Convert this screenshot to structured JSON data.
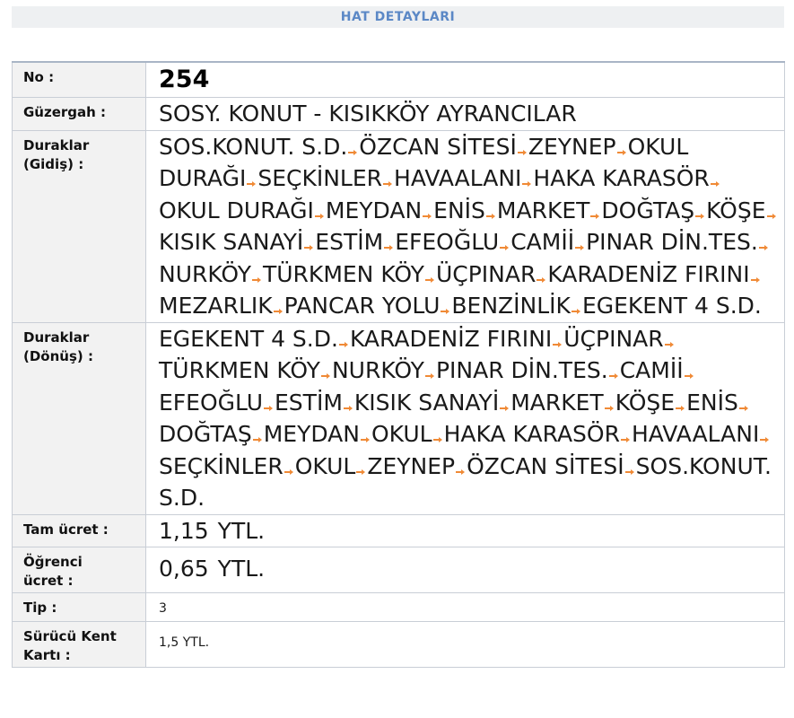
{
  "header": {
    "title": "HAT DETAYLARI"
  },
  "details": {
    "no_label": "No :",
    "no_value": "254",
    "route_label": "Güzergah :",
    "route_value": "SOSY. KONUT - KISIKKÖY AYRANCILAR",
    "stops_out_label_1": "Duraklar",
    "stops_out_label_2": "(Gidiş) :",
    "stops_out": [
      "SOS.KONUT. S.D.",
      "ÖZCAN SİTESİ",
      "ZEYNEP",
      "OKUL DURAĞI",
      "SEÇKİNLER",
      "HAVAALANI",
      "HAKA KARASÖR",
      "OKUL DURAĞI",
      "MEYDAN",
      "ENİS",
      "MARKET",
      "DOĞTAŞ",
      "KÖŞE",
      "KISIK SANAYİ",
      "ESTİM",
      "EFEOĞLU",
      "CAMİİ",
      "PINAR DİN.TES.",
      "NURKÖY",
      "TÜRKMEN KÖY",
      "ÜÇPINAR",
      "KARADENİZ FIRINI",
      "MEZARLIK",
      "PANCAR YOLU",
      "BENZİNLİK",
      "EGEKENT 4 S.D."
    ],
    "stops_back_label_1": "Duraklar",
    "stops_back_label_2": "(Dönüş) :",
    "stops_back": [
      "EGEKENT 4 S.D.",
      "KARADENİZ FIRINI",
      "ÜÇPINAR",
      "TÜRKMEN KÖY",
      "NURKÖY",
      "PINAR DİN.TES.",
      "CAMİİ",
      "EFEOĞLU",
      "ESTİM",
      "KISIK SANAYİ",
      "MARKET",
      "KÖŞE",
      "ENİS",
      "DOĞTAŞ",
      "MEYDAN",
      "OKUL",
      "HAKA KARASÖR",
      "HAVAALANI",
      "SEÇKİNLER",
      "OKUL",
      "ZEYNEP",
      "ÖZCAN SİTESİ",
      "SOS.KONUT. S.D."
    ],
    "full_fare_label": "Tam ücret :",
    "full_fare_amount": "1,15",
    "full_fare_unit": "YTL.",
    "student_fare_label_1": "Öğrenci",
    "student_fare_label_2": "ücret :",
    "student_fare_amount": "0,65",
    "student_fare_unit": "YTL.",
    "type_label": "Tip :",
    "type_value": "3",
    "driver_card_label_1": "Sürücü Kent",
    "driver_card_label_2": "Kartı :",
    "driver_card_value": "1,5 YTL."
  },
  "icons": {
    "stop_separator": "arrow-right-icon",
    "arrow_color": "#f08a36"
  },
  "colors": {
    "header_text": "#5b88c6",
    "header_bg": "#eef0f2",
    "label_bg": "#f2f2f2",
    "border": "#c9ced6"
  }
}
